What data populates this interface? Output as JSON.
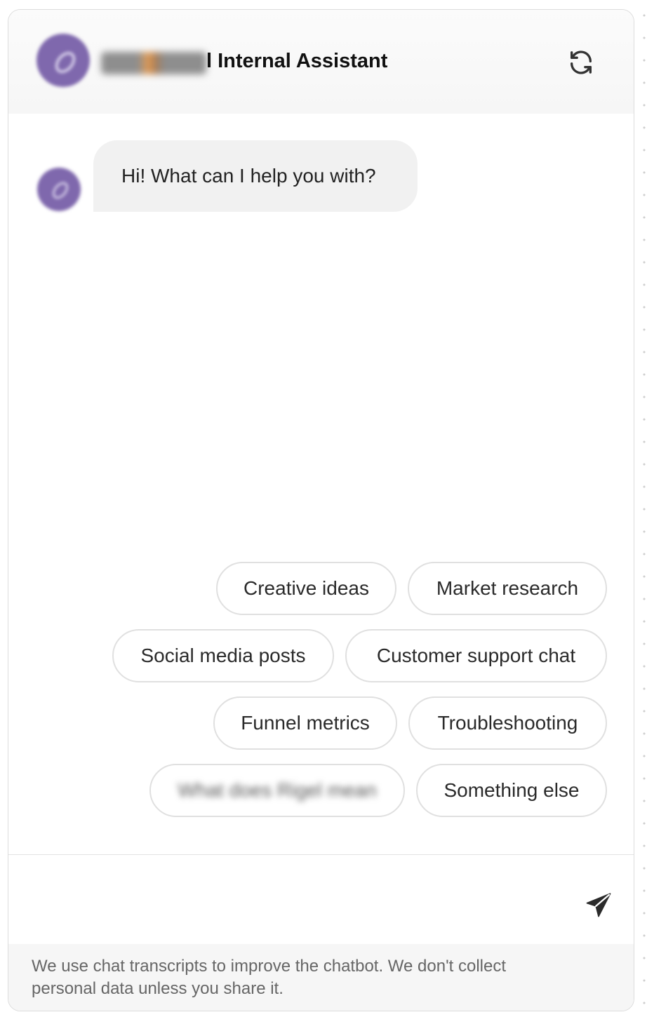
{
  "header": {
    "title": "l Internal Assistant",
    "avatar_icon": "assistant-logo-icon",
    "refresh_icon": "refresh-icon"
  },
  "conversation": {
    "greeting": "Hi! What can I help you with?"
  },
  "suggestions": [
    "Creative ideas",
    "Market research",
    "Social media posts",
    "Customer support chat",
    "Funnel metrics",
    "Troubleshooting",
    "What does Rigel mean",
    "Something else"
  ],
  "input": {
    "value": "",
    "placeholder": "",
    "send_icon": "send-icon"
  },
  "footer": {
    "disclaimer": "We use chat transcripts to improve the chatbot. We don't collect personal data unless you share it."
  },
  "colors": {
    "avatar": "#7f68ad",
    "bubble": "#f1f1f1",
    "chip_border": "#e0e0e0",
    "footer_bg": "#f6f6f6"
  }
}
